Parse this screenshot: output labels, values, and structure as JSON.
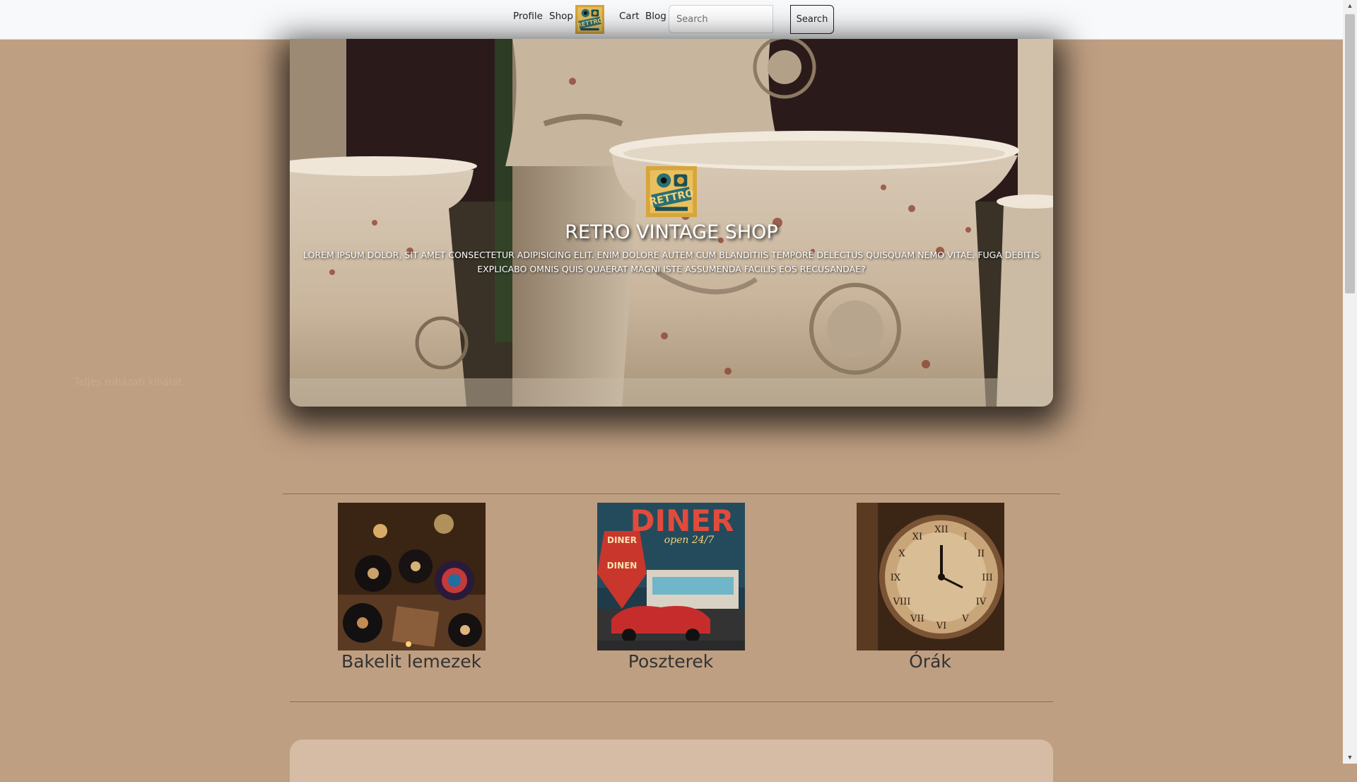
{
  "nav": {
    "links": [
      "Profile",
      "Shop",
      "Cart",
      "Blog"
    ],
    "search_placeholder": "Search",
    "search_button": "Search"
  },
  "hero": {
    "title": "RETRO VINTAGE SHOP",
    "text": "Lorem ipsum dolor, sit amet consectetur adipisicing elit. Enim dolore autem cum blanditiis tempore delectus quisquam nemo vitae, fuga debitis explicabo omnis quis quaerat magni iste assumenda facilis eos recusandae?"
  },
  "logo": {
    "text": "RETTRO"
  },
  "ghost_text": "Teljes ruházati kínálat",
  "categories": [
    {
      "label": "Bakelit lemezek"
    },
    {
      "label": "Poszterek"
    },
    {
      "label": "Órák"
    }
  ],
  "diner_poster": {
    "title": "DINER",
    "subtitle": "open 24/7",
    "sign_top": "DINER",
    "sign_bottom": "DINEN"
  },
  "colors": {
    "page_bg": "#bf9f82",
    "navbar_bg": "#f8f9fa",
    "panel_bg": "#d6bca4"
  }
}
